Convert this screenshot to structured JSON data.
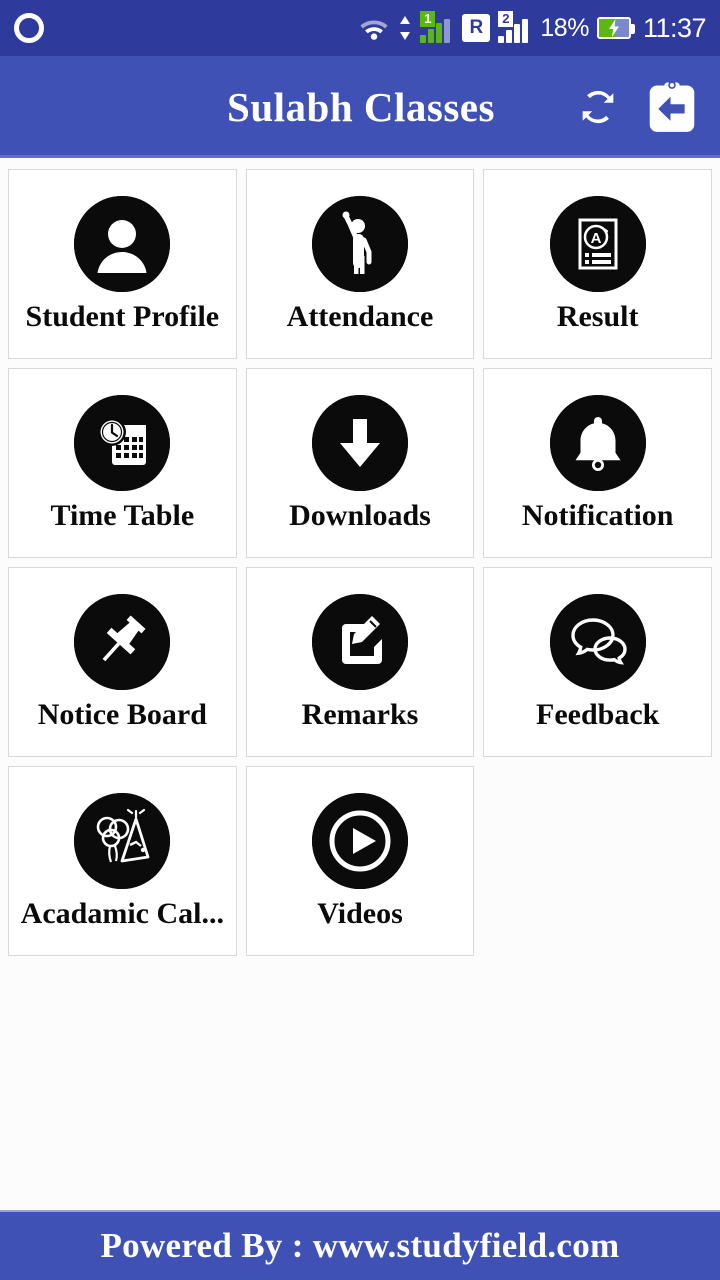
{
  "status_bar": {
    "app_logo": "opera-logo",
    "wifi": "wifi-icon",
    "data_transfer": "data-arrows-icon",
    "sim1_label": "1",
    "sim2_label": "2",
    "roaming_label": "R",
    "battery_percent": "18%",
    "battery_state": "charging",
    "time": "11:37"
  },
  "app_bar": {
    "title": "Sulabh Classes",
    "refresh_icon": "sync-refresh-icon",
    "logout_icon": "logout-clipboard-icon"
  },
  "grid": {
    "tiles": [
      {
        "label": "Student Profile",
        "icon": "user-profile-icon"
      },
      {
        "label": "Attendance",
        "icon": "raised-hand-person-icon"
      },
      {
        "label": "Result",
        "icon": "report-card-icon"
      },
      {
        "label": "Time Table",
        "icon": "clock-calendar-icon"
      },
      {
        "label": "Downloads",
        "icon": "download-arrow-icon"
      },
      {
        "label": "Notification",
        "icon": "bell-icon"
      },
      {
        "label": "Notice Board",
        "icon": "pushpin-icon"
      },
      {
        "label": "Remarks",
        "icon": "edit-pencil-square-icon"
      },
      {
        "label": "Feedback",
        "icon": "speech-bubbles-icon"
      },
      {
        "label": "Acadamic Cal...",
        "icon": "party-balloons-icon"
      },
      {
        "label": "Videos",
        "icon": "play-circle-icon"
      }
    ]
  },
  "footer": {
    "text": "Powered By : www.studyfield.com"
  },
  "colors": {
    "status_bar": "#2f3b9c",
    "app_bar": "#3f51b5",
    "icon_badge": "#0b0b0b",
    "page_background": "#fcfcfc",
    "sim1_green": "#5cb811"
  }
}
